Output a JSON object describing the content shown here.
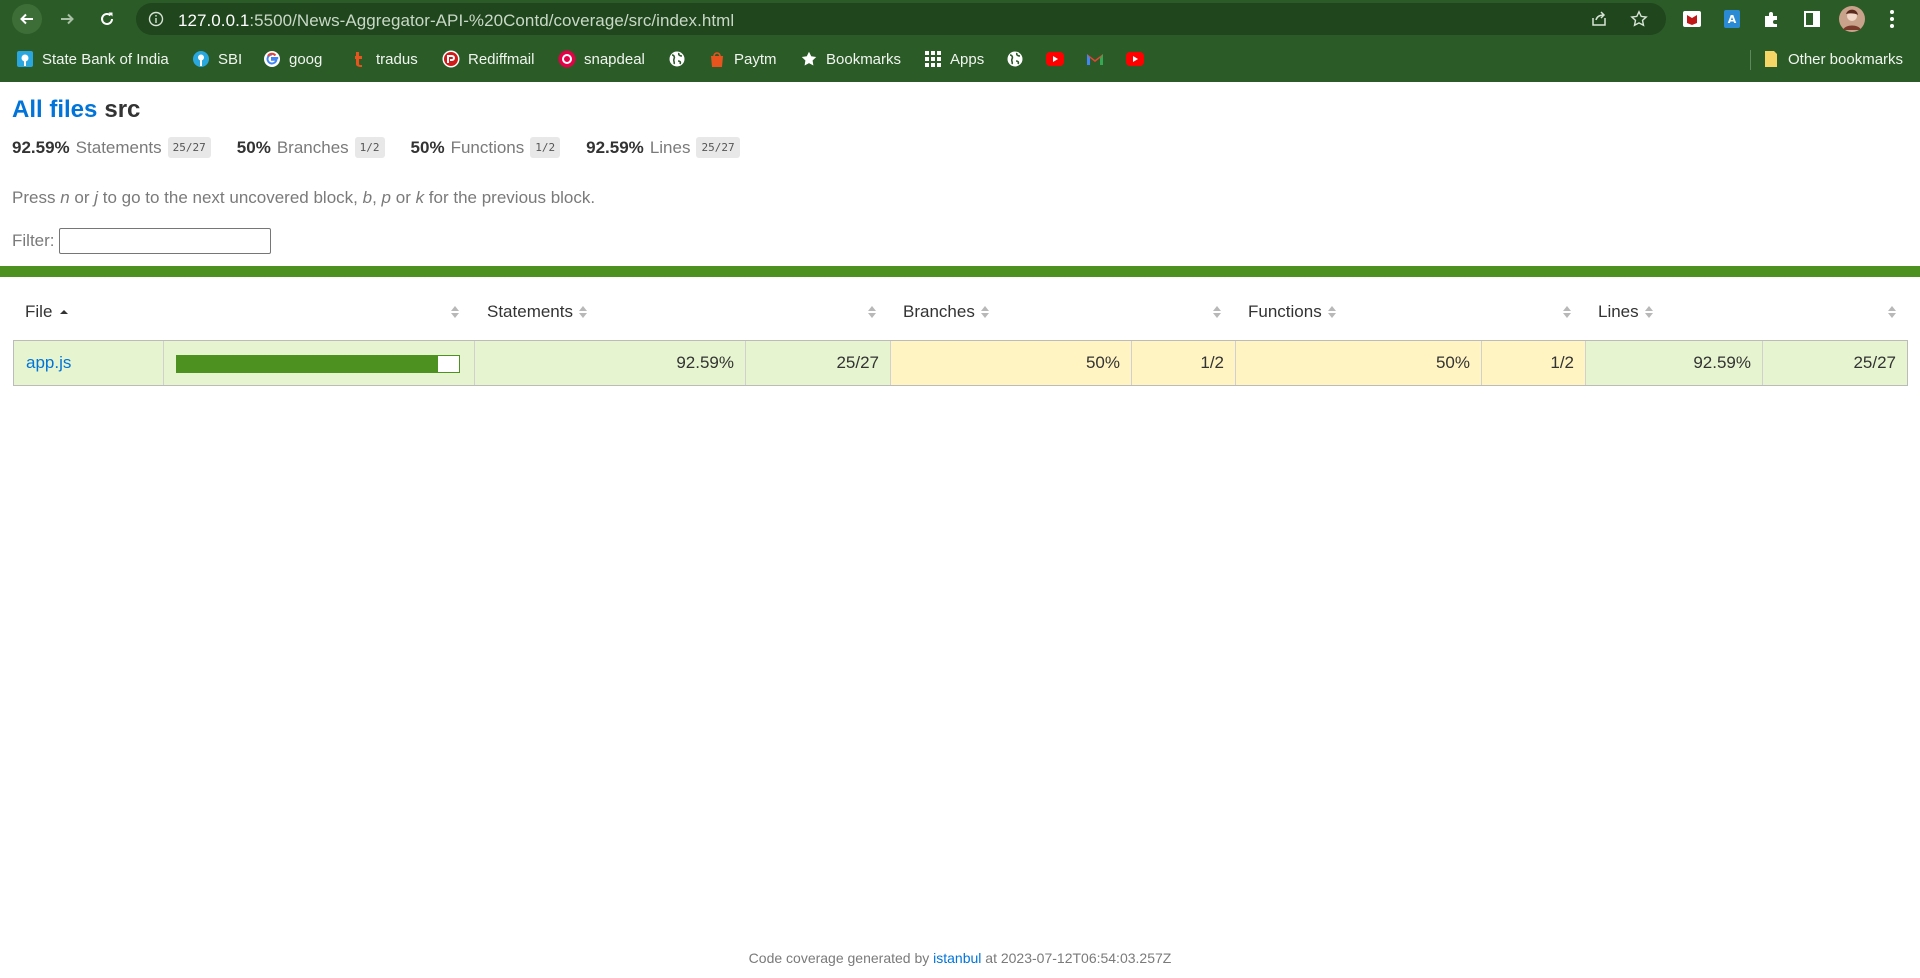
{
  "browser": {
    "url_host": "127.0.0.1",
    "url_path": ":5500/News-Aggregator-API-%20Contd/coverage/src/index.html",
    "bookmarks": [
      {
        "label": "State Bank of India",
        "icon": "sbi-logo-icon"
      },
      {
        "label": "SBI",
        "icon": "sbi-icon"
      },
      {
        "label": "goog",
        "icon": "google-icon"
      },
      {
        "label": "tradus",
        "icon": "tradus-icon"
      },
      {
        "label": "Rediffmail",
        "icon": "rediffmail-icon"
      },
      {
        "label": "snapdeal",
        "icon": "snapdeal-icon"
      },
      {
        "label": "",
        "icon": "globe-icon"
      },
      {
        "label": "Paytm",
        "icon": "paytm-bag-icon"
      },
      {
        "label": "Bookmarks",
        "icon": "star-icon"
      },
      {
        "label": "Apps",
        "icon": "apps-grid-icon"
      },
      {
        "label": "",
        "icon": "globe-icon"
      },
      {
        "label": "",
        "icon": "youtube-icon"
      },
      {
        "label": "",
        "icon": "gmail-icon"
      },
      {
        "label": "",
        "icon": "youtube-icon"
      }
    ],
    "other_bookmarks": "Other bookmarks",
    "colors": {
      "frame": "#2b5b27",
      "omnibox": "#1f461c"
    }
  },
  "report": {
    "all_files_link": "All files",
    "current_dir": "src",
    "summary": [
      {
        "pct": "92.59%",
        "label": "Statements",
        "fraction": "25/27"
      },
      {
        "pct": "50%",
        "label": "Branches",
        "fraction": "1/2"
      },
      {
        "pct": "50%",
        "label": "Functions",
        "fraction": "1/2"
      },
      {
        "pct": "92.59%",
        "label": "Lines",
        "fraction": "25/27"
      }
    ],
    "hint": {
      "t1": "Press ",
      "k1": "n",
      "t2": " or ",
      "k2": "j",
      "t3": " to go to the next uncovered block, ",
      "k3": "b",
      "t4": ", ",
      "k4": "p",
      "t5": " or ",
      "k5": "k",
      "t6": " for the previous block."
    },
    "filter_label": "Filter:",
    "filter_value": "",
    "columns": {
      "file": "File",
      "statements": "Statements",
      "branches": "Branches",
      "functions": "Functions",
      "lines": "Lines"
    },
    "rows": [
      {
        "file": "app.js",
        "coverage_fraction": 0.9259,
        "statements_pct": "92.59%",
        "statements_frac": "25/27",
        "branches_pct": "50%",
        "branches_frac": "1/2",
        "functions_pct": "50%",
        "functions_frac": "1/2",
        "lines_pct": "92.59%",
        "lines_frac": "25/27"
      }
    ],
    "colors": {
      "high": "#e6f5d0",
      "medium": "#fff4c2",
      "bar": "#4d9221",
      "link": "#0074d9"
    },
    "footer": {
      "prefix": "Code coverage generated by",
      "tool": "istanbul",
      "suffix": "at 2023-07-12T06:54:03.257Z"
    }
  }
}
